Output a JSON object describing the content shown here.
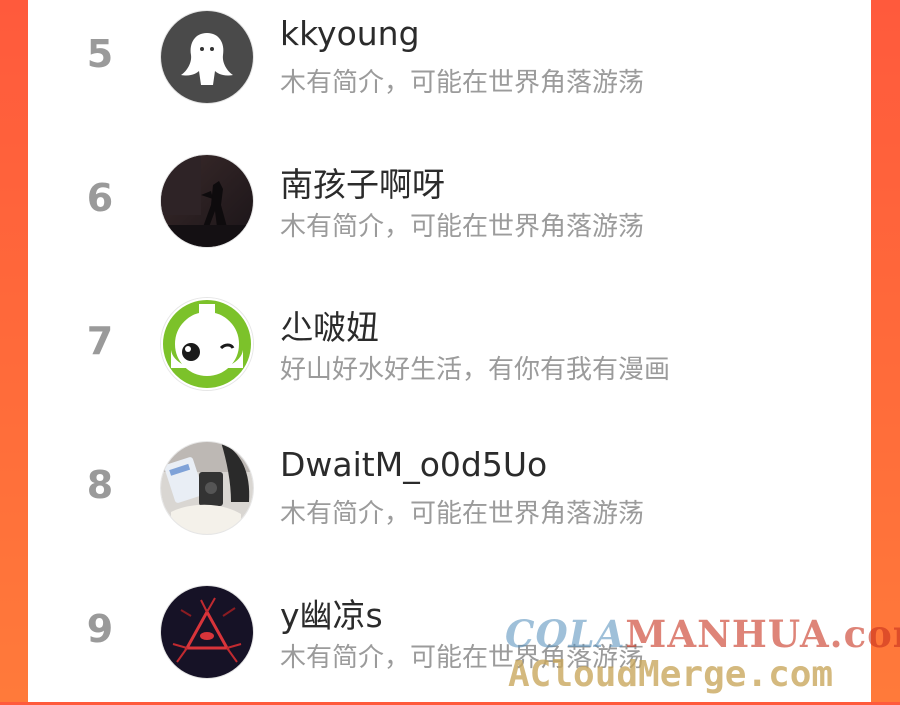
{
  "list": {
    "rows": [
      {
        "rank": "5",
        "name": "kkyoung",
        "bio": "木有简介，可能在世界角落游荡",
        "avatar": "ghost-avatar-icon"
      },
      {
        "rank": "6",
        "name": "南孩子啊呀",
        "bio": "木有简介，可能在世界角落游荡",
        "avatar": "dark-photo-avatar"
      },
      {
        "rank": "7",
        "name": "尐啵妞",
        "bio": "好山好水好生活，有你有我有漫画",
        "avatar": "green-mascot-avatar"
      },
      {
        "rank": "8",
        "name": "DwaitM_o0d5Uo",
        "bio": "木有简介，可能在世界角落游荡",
        "avatar": "phone-photo-avatar"
      },
      {
        "rank": "9",
        "name": "y幽凉s",
        "bio": "木有简介，可能在世界角落游荡",
        "avatar": "red-eye-triangle-avatar"
      }
    ]
  },
  "watermark": {
    "part1": "COLA",
    "part2": "MANHUA.com",
    "line2": "ACloudMerge.com"
  },
  "colors": {
    "background_left": "#ff5a3c",
    "background_right": "#ff7a3a",
    "panel": "#ffffff",
    "rank": "#9a9a9a",
    "name": "#2b2b2b",
    "bio": "#9b9b9b"
  }
}
